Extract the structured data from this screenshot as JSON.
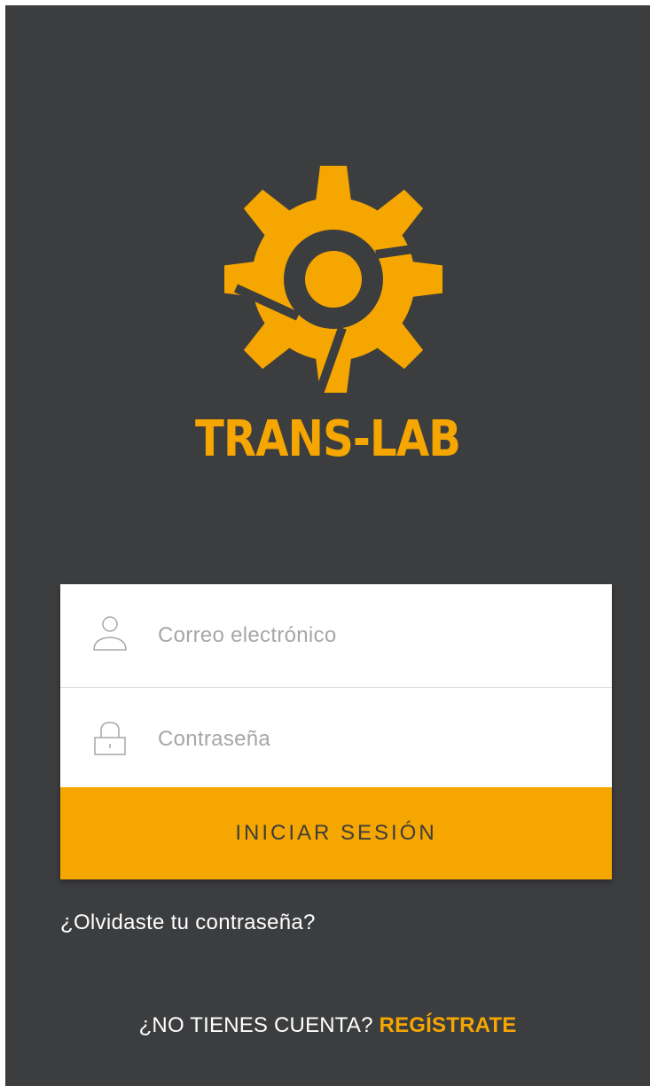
{
  "app": {
    "brand_name": "TRANS-LAB",
    "logo_icon": "gear-logo-icon"
  },
  "colors": {
    "background": "#3c3d3f",
    "accent": "#f5a600",
    "card": "#ffffff",
    "button_text": "#3d3d3d",
    "placeholder": "#a7a7a7"
  },
  "login_form": {
    "email": {
      "icon": "user-icon",
      "placeholder": "Correo electrónico",
      "value": ""
    },
    "password": {
      "icon": "lock-icon",
      "placeholder": "Contraseña",
      "value": ""
    },
    "submit_label": "INICIAR SESIÓN"
  },
  "links": {
    "forgot_password": "¿Olvidaste tu contraseña?",
    "no_account_prompt": "¿NO TIENES CUENTA?",
    "register": "REGÍSTRATE"
  }
}
